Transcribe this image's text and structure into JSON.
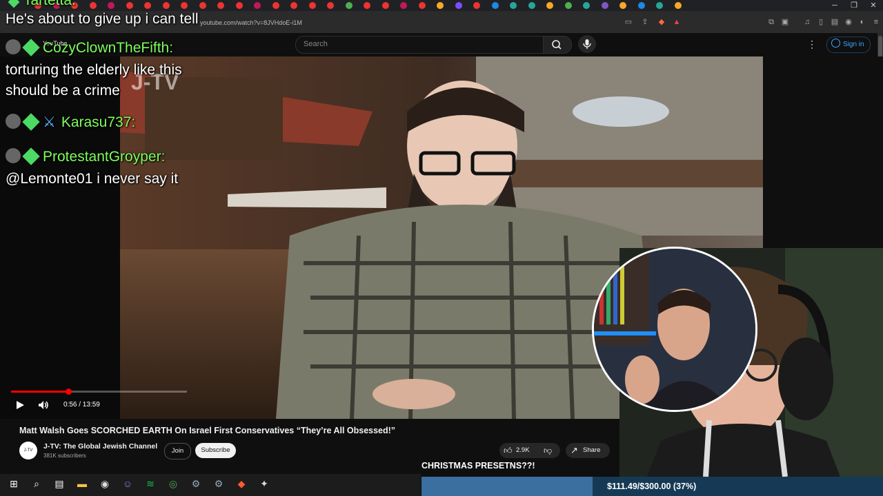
{
  "browser": {
    "url": "youtube.com/watch?v=8JVHdoE-i1M"
  },
  "youtube": {
    "logo_text": "YouTube",
    "search_placeholder": "Search",
    "sign_in_label": "Sign in"
  },
  "video": {
    "title": "Matt Walsh Goes SCORCHED EARTH On Israel First Conservatives “They’re All Obsessed!”",
    "time": "0:56 / 13:59",
    "progress_fraction": 0.067,
    "watermark": "J-TV"
  },
  "channel": {
    "avatar_text": "J-TV",
    "name": "J-TV: The Global Jewish Channel",
    "subscribers": "381K subscribers",
    "join_label": "Join",
    "subscribe_label": "Subscribe",
    "like_count": "2.9K",
    "share_label": "Share"
  },
  "chat": [
    {
      "name": "CozyClownTheFifth:",
      "message_lines": [
        "torturing the elderly like this",
        "should be a crime"
      ]
    },
    {
      "name": "Karasu737:",
      "message_lines": []
    },
    {
      "name": "ProtestantGroyper:",
      "message_lines": [
        "@Lemonte01 i never say it"
      ]
    }
  ],
  "chat_top": "He's about to give up i can tell",
  "chat_top_partial_name": "Tartetta:",
  "stream_goal": {
    "label": "CHRISTMAS PRESETNS??!",
    "amount_text": "$111.49/$300.00 (37%)",
    "fraction": 0.37
  },
  "colors": {
    "chat_name": "#7dff5a",
    "yt_red": "#ff0000",
    "goal_fill": "#3a6fa0",
    "goal_bg": "#163a55",
    "link_blue": "#3ea6ff"
  },
  "taskbar_icons": [
    "windows-icon",
    "search-icon",
    "task-view-icon",
    "file-explorer-icon",
    "obs-icon",
    "discord-icon",
    "spotify-icon",
    "chrome-icon",
    "steam-icon",
    "steam-icon",
    "brave-icon",
    "app-icon"
  ]
}
